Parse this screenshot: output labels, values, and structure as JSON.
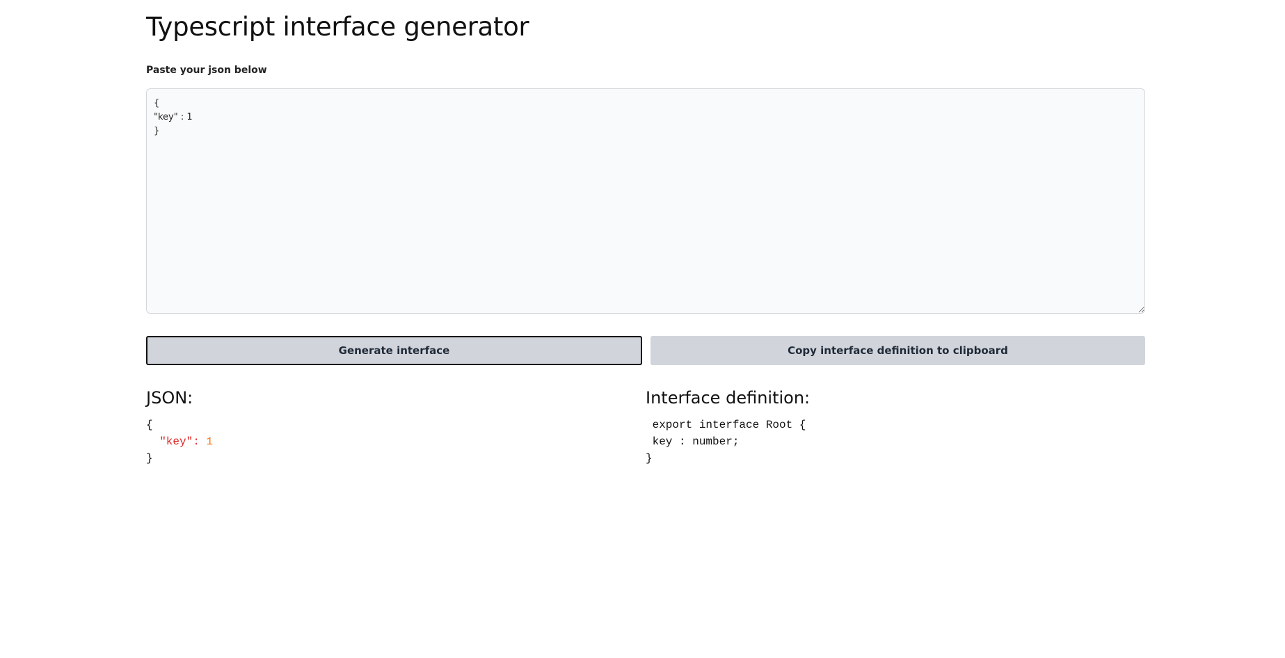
{
  "header": {
    "title": "Typescript interface generator"
  },
  "input": {
    "label": "Paste your json below",
    "value": "{\n\"key\" : 1\n}"
  },
  "actions": {
    "generate_label": "Generate interface",
    "copy_label": "Copy interface definition to clipboard"
  },
  "json_output": {
    "title": "JSON:",
    "open_brace": "{",
    "key": "\"key\":",
    "value": "1",
    "close_brace": "}"
  },
  "interface_output": {
    "title": "Interface definition:",
    "line1": " export interface Root {",
    "line2": " key : number;",
    "line3": "}"
  },
  "colors": {
    "json_key": "#dc2626",
    "json_number": "#f97316",
    "button_bg": "#d1d5db",
    "textarea_bg": "#f9fafb"
  }
}
